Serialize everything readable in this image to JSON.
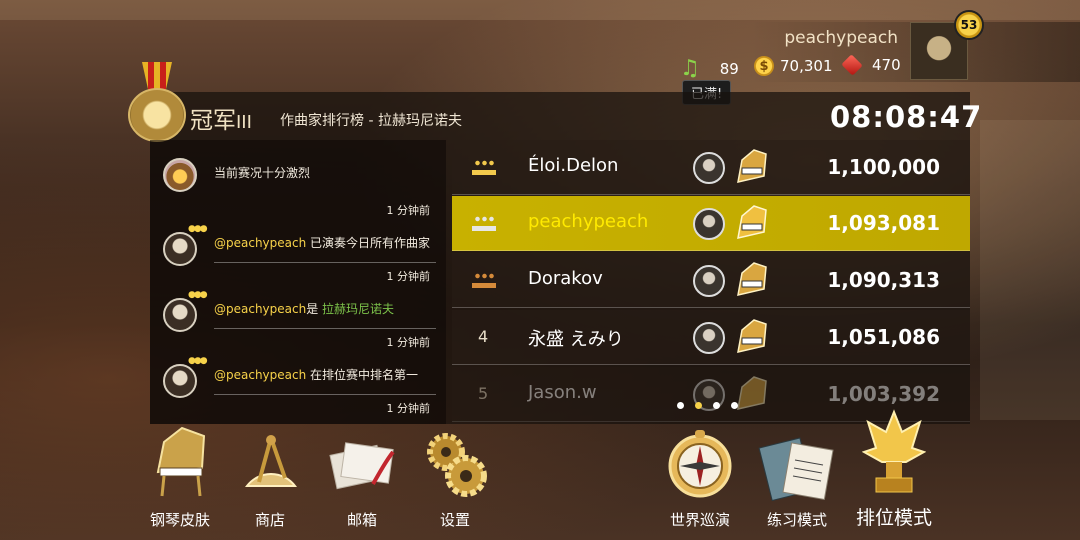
{
  "profile": {
    "username": "peachypeach",
    "level": "53",
    "notes": "89",
    "coins": "70,301",
    "gems": "470",
    "full_tip": "已满!"
  },
  "header": {
    "rank_title": "冠军",
    "rank_roman": "III",
    "board_name": "作曲家排行榜 - 拉赫玛尼诺夫",
    "timer": "08:08:47"
  },
  "feed": [
    {
      "text": "当前赛况十分激烈",
      "time": "1 分钟前"
    },
    {
      "user": "@peachypeach",
      "text": " 已演奏今日所有作曲家",
      "time": "1 分钟前"
    },
    {
      "user": "@peachypeach",
      "text": "是 ",
      "highlight": "拉赫玛尼诺夫",
      "time": "1 分钟前"
    },
    {
      "user": "@peachypeach",
      "text": " 在排位赛中排名第一",
      "time": "1 分钟前"
    }
  ],
  "leaderboard": [
    {
      "rank": "1",
      "name": "Éloi.Delon",
      "score": "1,100,000",
      "medal": "gold"
    },
    {
      "rank": "2",
      "name": "peachypeach",
      "score": "1,093,081",
      "medal": "silver"
    },
    {
      "rank": "3",
      "name": "Dorakov",
      "score": "1,090,313",
      "medal": "bronze"
    },
    {
      "rank": "4",
      "name": "永盛 えみり",
      "score": "1,051,086"
    },
    {
      "rank": "5",
      "name": "Jason.w",
      "score": "1,003,392"
    }
  ],
  "pager": {
    "count": 4,
    "active": 1
  },
  "toolbar": {
    "piano_skin": "钢琴皮肤",
    "shop": "商店",
    "mailbox": "邮箱",
    "settings": "设置",
    "world_tour": "世界巡演",
    "practice": "练习模式",
    "ranked": "排位模式"
  },
  "colors": {
    "accent": "#f7d24a",
    "highlight_row": "#c8b100",
    "green": "#7cc24a"
  }
}
